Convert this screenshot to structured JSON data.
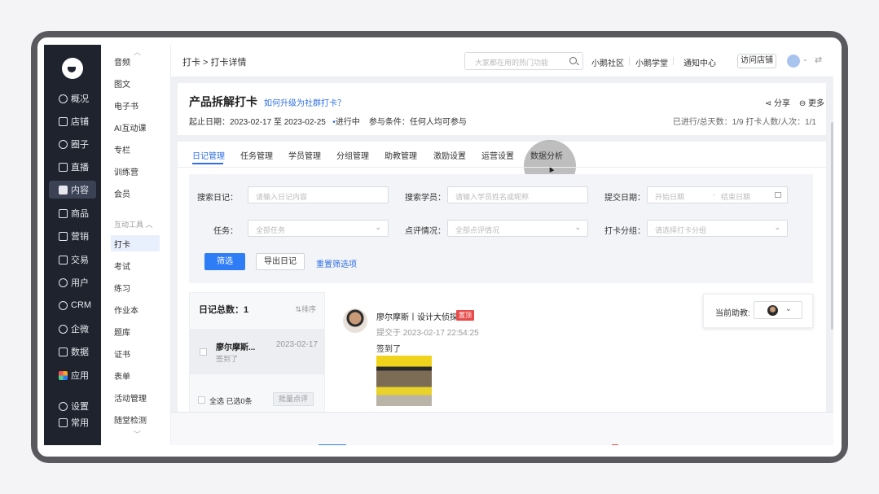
{
  "breadcrumb": "打卡 > 打卡详情",
  "search": {
    "placeholder": "大家都在用的热门功能"
  },
  "header_links": [
    "小鹅社区",
    "小鹅学堂",
    "通知中心"
  ],
  "visit_store": "访问店铺",
  "nav": [
    {
      "label": "概况",
      "icon": "clock-icon"
    },
    {
      "label": "店铺",
      "icon": "store-icon"
    },
    {
      "label": "圈子",
      "icon": "community-icon"
    },
    {
      "label": "直播",
      "icon": "live-icon"
    },
    {
      "label": "内容",
      "icon": "content-icon",
      "active": true
    },
    {
      "label": "商品",
      "icon": "goods-icon"
    },
    {
      "label": "营销",
      "icon": "megaphone-icon"
    },
    {
      "label": "交易",
      "icon": "trade-icon"
    },
    {
      "label": "用户",
      "icon": "user-icon"
    },
    {
      "label": "CRM",
      "icon": "crm-icon"
    },
    {
      "label": "企微",
      "icon": "wecom-icon"
    },
    {
      "label": "数据",
      "icon": "data-icon"
    },
    {
      "label": "应用",
      "icon": "apps-icon"
    },
    {
      "label": "设置",
      "icon": "settings-icon"
    },
    {
      "label": "常用",
      "icon": "menu-icon"
    }
  ],
  "subnav": {
    "items_top": [
      "音频",
      "图文",
      "电子书",
      "AI互动课",
      "专栏",
      "训练营",
      "会员"
    ],
    "group": "互动工具",
    "items_bottom": [
      "打卡",
      "考试",
      "练习",
      "作业本",
      "题库",
      "证书",
      "表单",
      "活动管理",
      "随堂检测"
    ],
    "active": "打卡"
  },
  "page": {
    "title": "产品拆解打卡",
    "title_link": "如何升级为社群打卡？",
    "share": "分享",
    "more": "更多",
    "date_range": "起止日期：2023-02-17 至 2023-02-25",
    "status": "进行中",
    "condition": "参与条件：任何人均可参与",
    "stats": "已进行/总天数：1/9   打卡人数/人次：1/1"
  },
  "tabs": [
    "日记管理",
    "任务管理",
    "学员管理",
    "分组管理",
    "助教管理",
    "激励设置",
    "运营设置",
    "数据分析"
  ],
  "filters": {
    "search_diary_label": "搜索日记：",
    "search_diary_placeholder": "请输入日记内容",
    "search_student_label": "搜索学员：",
    "search_student_placeholder": "请输入学员姓名或昵称",
    "submit_date_label": "提交日期：",
    "date_start": "开始日期",
    "date_sep": "-",
    "date_end": "结束日期",
    "task_label": "任务：",
    "task_value": "全部任务",
    "review_label": "点评情况：",
    "review_value": "全部点评情况",
    "group_label": "打卡分组：",
    "group_placeholder": "请选择打卡分组",
    "filter_btn": "筛选",
    "export_btn": "导出日记",
    "reset_link": "重置筛选项"
  },
  "list": {
    "title": "日记总数：1",
    "sort": "排序",
    "row": {
      "name": "廖尔摩斯...",
      "sub": "签到了",
      "date": "2023-02-17"
    },
    "select_all": "全选  已选0条",
    "batch_review": "批量点评"
  },
  "post": {
    "author": "廖尔摩斯丨设计大侦探",
    "tag": "置顶",
    "time": "提交于 2023-02-17 22:54:25",
    "text": "签到了"
  },
  "helper": {
    "label": "当前助教:"
  }
}
